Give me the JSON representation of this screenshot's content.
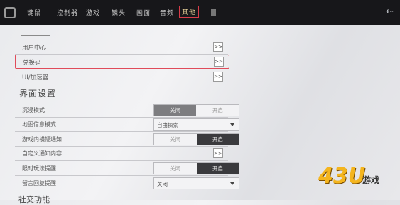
{
  "tabs": [
    "键鼠",
    "控制器",
    "游戏",
    "镜头",
    "画面",
    "音频",
    "其他"
  ],
  "active_tab_index": 6,
  "rows": [
    {
      "label": "用户中心",
      "action": ">>"
    },
    {
      "label": "兑换码",
      "action": ">>",
      "highlighted": true
    },
    {
      "label": "UI/加速器",
      "action": ">>"
    }
  ],
  "section_title": "界面设置",
  "settings": [
    {
      "label": "沉浸模式",
      "type": "toggle",
      "off": "关闭",
      "on": "开启",
      "selected": "off"
    },
    {
      "label": "地图信息模式",
      "type": "select",
      "value": "自由探索"
    },
    {
      "label": "游戏内横幅通知",
      "type": "toggle",
      "off": "关闭",
      "on": "开启",
      "selected": "on"
    },
    {
      "label": "自定义通知内容",
      "type": "action",
      "action": ">>"
    },
    {
      "label": "限时玩法提醒",
      "type": "toggle",
      "off": "关闭",
      "on": "开启",
      "selected": "on"
    },
    {
      "label": "留言回复提醒",
      "type": "select",
      "value": "关闭"
    }
  ],
  "bottom_title": "社交功能",
  "watermark": {
    "num": "43U",
    "text": "游戏"
  }
}
